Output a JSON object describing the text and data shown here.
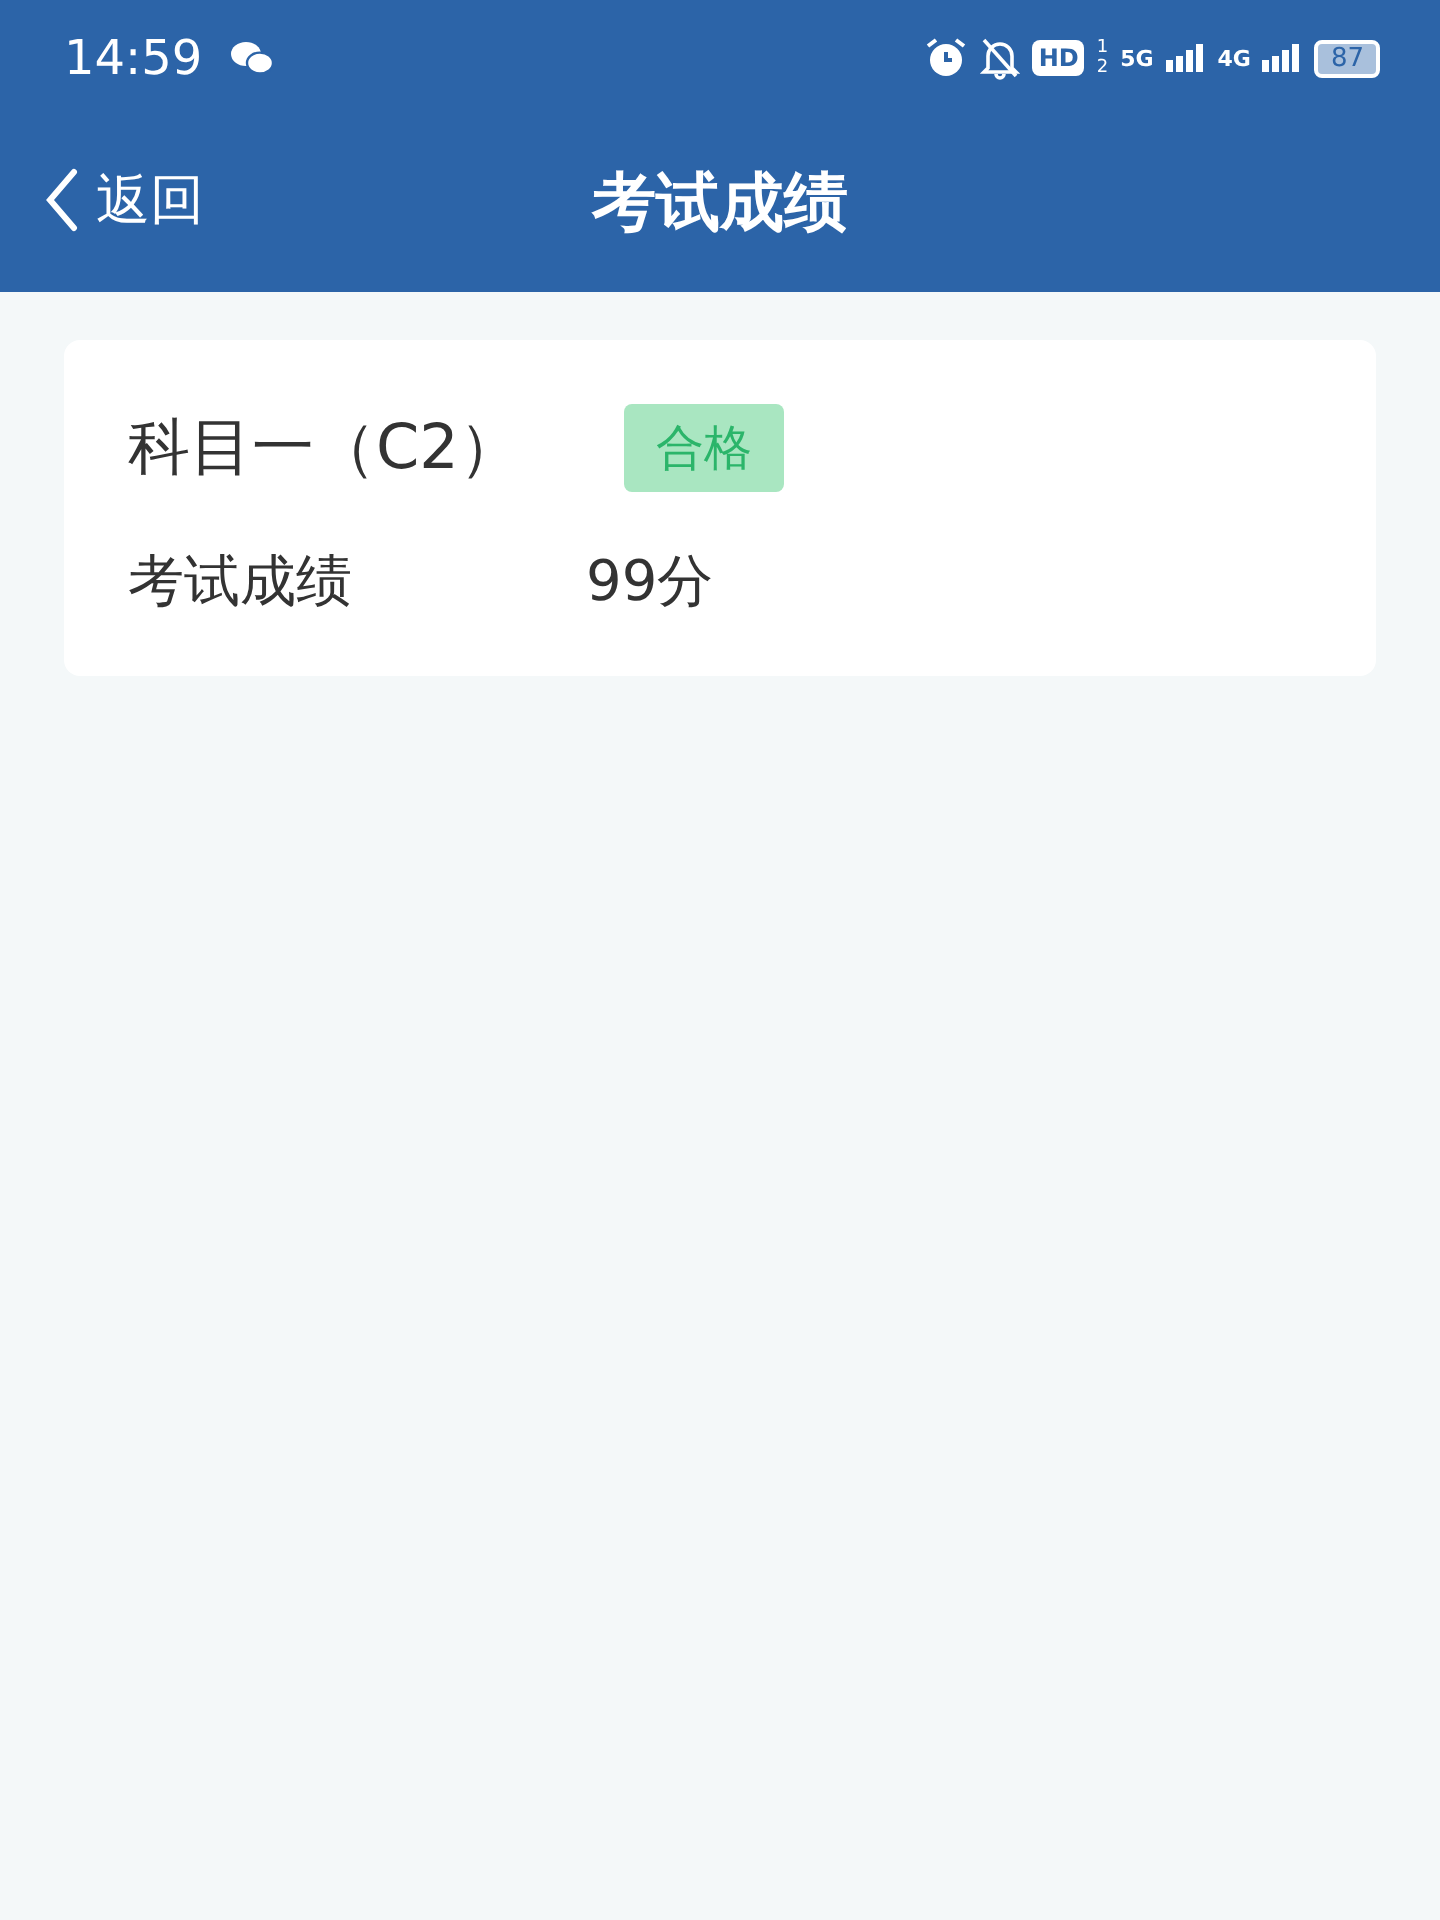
{
  "status_bar": {
    "time": "14:59",
    "hd": "HD",
    "sims": [
      "1",
      "2"
    ],
    "networks": [
      "5G",
      "4G"
    ],
    "battery": "87"
  },
  "nav": {
    "back": "返回",
    "title": "考试成绩"
  },
  "result": {
    "subject": "科目一（C2）",
    "badge": {
      "label": "合格",
      "passed": true
    },
    "score_label": "考试成绩",
    "score": "99分"
  }
}
